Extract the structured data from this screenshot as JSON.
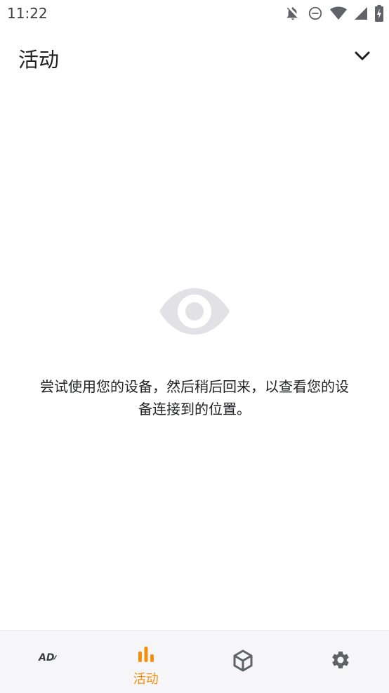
{
  "status_bar": {
    "time": "11:22",
    "icons": [
      "notifications-off-icon",
      "do-not-disturb-icon",
      "wifi-icon",
      "cellular-icon",
      "battery-charging-icon"
    ]
  },
  "app_bar": {
    "title": "活动",
    "dropdown_icon": "chevron-down-icon"
  },
  "empty_state": {
    "icon": "eye-icon",
    "message": "尝试使用您的设备，然后稍后回来，以查看您的设备连接到的位置。"
  },
  "bottom_nav": {
    "items": [
      {
        "id": "adblock",
        "icon": "adblock-icon",
        "label": "",
        "active": false
      },
      {
        "id": "activity",
        "icon": "bar-chart-icon",
        "label": "活动",
        "active": true
      },
      {
        "id": "packages",
        "icon": "cube-icon",
        "label": "",
        "active": false
      },
      {
        "id": "settings",
        "icon": "gear-icon",
        "label": "",
        "active": false
      }
    ]
  },
  "colors": {
    "accent": "#f4900c",
    "nav_background": "#f6f6f8",
    "icon_gray": "#5f6368",
    "eye_gray": "#e2e2e6"
  }
}
